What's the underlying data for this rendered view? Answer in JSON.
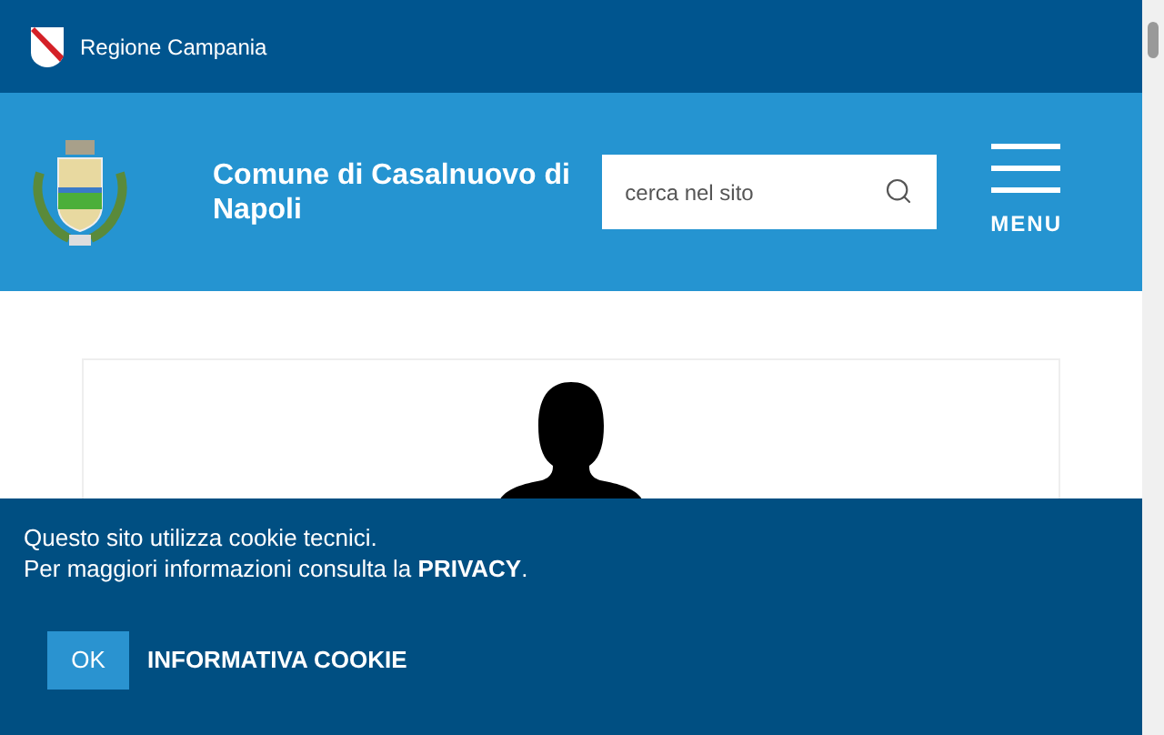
{
  "top_bar": {
    "region_name": "Regione Campania"
  },
  "header": {
    "title": "Comune di Casalnuovo di Napoli",
    "search": {
      "placeholder": "cerca nel sito"
    },
    "menu_label": "MENU"
  },
  "cookie_banner": {
    "line_1": "Questo sito utilizza cookie tecnici.",
    "line_2_prefix": "Per maggiori informazioni consulta la ",
    "privacy_link": "PRIVACY",
    "line_2_suffix": ".",
    "ok_button": "OK",
    "info_link": "INFORMATIVA COOKIE"
  }
}
